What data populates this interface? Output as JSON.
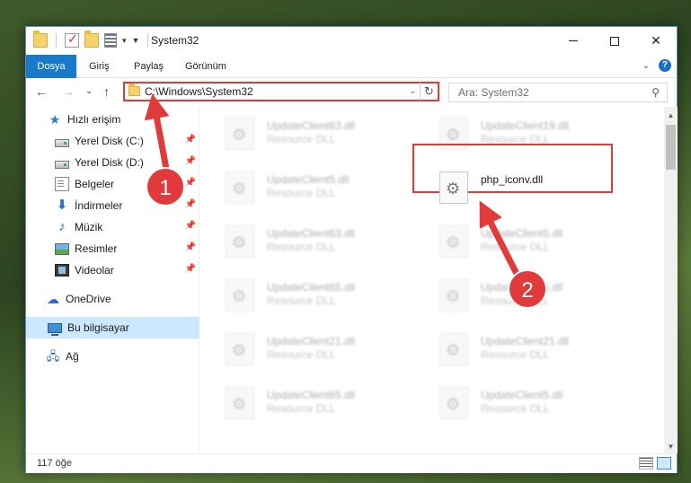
{
  "window": {
    "title": "System32"
  },
  "ribbon": {
    "tabs": [
      "Dosya",
      "Giriş",
      "Paylaş",
      "Görünüm"
    ],
    "help": "?"
  },
  "nav": {
    "back": "←",
    "forward": "→",
    "recent": "⌄",
    "up": "↑",
    "address": "C:\\Windows\\System32",
    "search_placeholder": "Ara: System32"
  },
  "sidebar": {
    "items": [
      {
        "label": "Hızlı erişim",
        "icon": "star-icon",
        "pinned": false
      },
      {
        "label": "Yerel Disk (C:)",
        "icon": "disk-icon",
        "pinned": true
      },
      {
        "label": "Yerel Disk (D:)",
        "icon": "disk-icon",
        "pinned": true
      },
      {
        "label": "Belgeler",
        "icon": "documents-icon",
        "pinned": true
      },
      {
        "label": "İndirmeler",
        "icon": "downloads-icon",
        "pinned": true
      },
      {
        "label": "Müzik",
        "icon": "music-icon",
        "pinned": true
      },
      {
        "label": "Resimler",
        "icon": "pictures-icon",
        "pinned": true
      },
      {
        "label": "Videolar",
        "icon": "videos-icon",
        "pinned": true
      },
      {
        "label": "OneDrive",
        "icon": "cloud-icon",
        "pinned": false
      },
      {
        "label": "Bu bilgisayar",
        "icon": "computer-icon",
        "pinned": false,
        "selected": true
      },
      {
        "label": "Ağ",
        "icon": "network-icon",
        "pinned": false
      }
    ]
  },
  "files": {
    "left": [
      {
        "name": "UpdateClient63.dll",
        "type": "Resource DLL"
      },
      {
        "name": "UpdateClient5.dll",
        "type": "Resource DLL"
      },
      {
        "name": "UpdateClient63.dll",
        "type": "Resource DLL"
      },
      {
        "name": "UpdateClient65.dll",
        "type": "Resource DLL"
      },
      {
        "name": "UpdateClient21.dll",
        "type": "Resource DLL"
      },
      {
        "name": "UpdateClient65.dll",
        "type": "Resource DLL"
      }
    ],
    "right": [
      {
        "name": "UpdateClient19.dll",
        "type": "Resource DLL"
      },
      {
        "name": "php_iconv.dll",
        "type": ""
      },
      {
        "name": "UpdateClient5.dll",
        "type": "Resource DLL"
      },
      {
        "name": "UpdateClient5.dll",
        "type": "Resource DLL"
      },
      {
        "name": "UpdateClient21.dll",
        "type": "Resource DLL"
      },
      {
        "name": "UpdateClient5.dll",
        "type": "Resource DLL"
      }
    ]
  },
  "status": {
    "count": "117 öğe"
  },
  "annotations": {
    "step1": "1",
    "step2": "2",
    "color": "#e03a3a"
  }
}
